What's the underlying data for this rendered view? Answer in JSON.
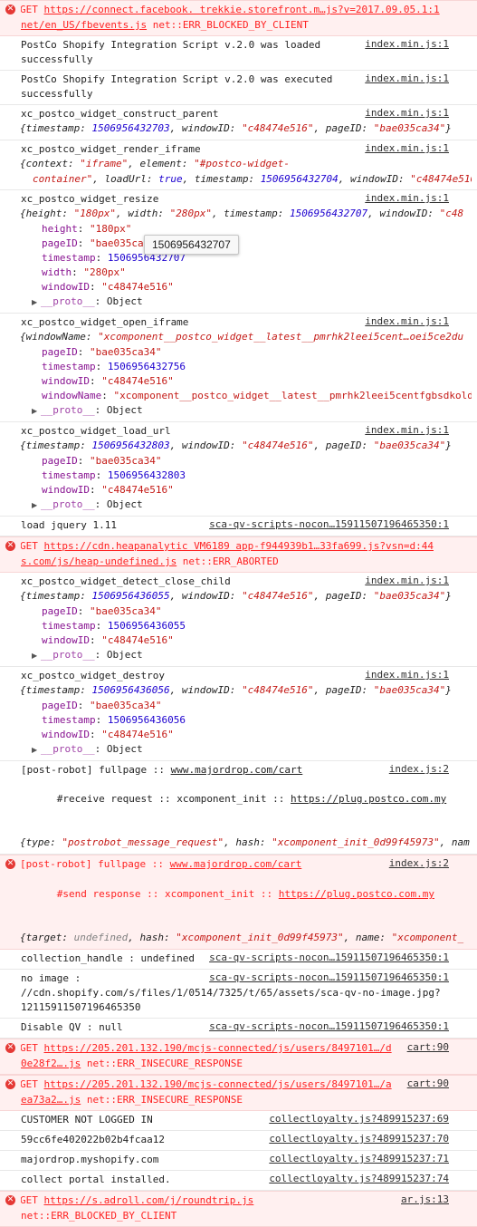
{
  "colors": {
    "error_text": "#fe2222",
    "error_bg": "#fff0f0",
    "string": "#c41a16",
    "number": "#1c00cf",
    "key": "#881391"
  },
  "tooltip": "1506956432707",
  "e1": {
    "l1a": "GET ",
    "url": "https://connect.facebook. trekkie.storefront.m…js?v=2017.09.05.1:1",
    "l2a": "net/en_US/fbevents.js",
    "l2b": " net::ERR_BLOCKED_BY_CLIENT"
  },
  "e2": {
    "text": "PostCo Shopify Integration Script v.2.0 was loaded successfully",
    "src": "index.min.js:1"
  },
  "e3": {
    "text": "PostCo Shopify Integration Script v.2.0 was executed successfully",
    "src": "index.min.js:1"
  },
  "e4": {
    "title": "xc_postco_widget_construct_parent",
    "src": "index.min.js:1",
    "obj": [
      "{timestamp: ",
      "1506956432703",
      ", windowID: ",
      "\"c48474e516\"",
      ", pageID: ",
      "\"bae035ca34\"",
      "}"
    ]
  },
  "e5": {
    "title": "xc_postco_widget_render_iframe",
    "src": "index.min.js:1",
    "l1": [
      "{context: ",
      "\"iframe\"",
      ", element: ",
      "\"#postco-widget-"
    ],
    "l2": [
      "container\"",
      ", loadUrl: ",
      "true",
      ", timestamp: ",
      "1506956432704",
      ", windowID: ",
      "\"c48474e516"
    ]
  },
  "e6": {
    "title": "xc_postco_widget_resize",
    "src": "index.min.js:1",
    "obj": [
      "{height: ",
      "\"180px\"",
      ", width: ",
      "\"280px\"",
      ", timestamp: ",
      "1506956432707",
      ", windowID: ",
      "\"c48"
    ],
    "props": [
      [
        "height",
        "\"180px\""
      ],
      [
        "pageID",
        "\"bae035ca34\""
      ],
      [
        "timestamp",
        "1506956432707"
      ],
      [
        "width",
        "\"280px\""
      ],
      [
        "windowID",
        "\"c48474e516\""
      ]
    ],
    "proto": "__proto__",
    "proto_val": "Object"
  },
  "e7": {
    "title": "xc_postco_widget_open_iframe",
    "src": "index.min.js:1",
    "obj": [
      "{windowName: ",
      "\"xcomponent__postco_widget__latest__pmrhk2leei5cent…oei5ce2du"
    ],
    "props": [
      [
        "pageID",
        "\"bae035ca34\""
      ],
      [
        "timestamp",
        "1506956432756"
      ],
      [
        "windowID",
        "\"c48474e516\""
      ],
      [
        "windowName",
        "\"xcomponent__postco_widget__latest__pmrhk2leei5centfgbsdkoldg"
      ]
    ],
    "proto": "__proto__",
    "proto_val": "Object"
  },
  "e8": {
    "title": "xc_postco_widget_load_url",
    "src": "index.min.js:1",
    "obj": [
      "{timestamp: ",
      "1506956432803",
      ", windowID: ",
      "\"c48474e516\"",
      ", pageID: ",
      "\"bae035ca34\"",
      "}"
    ],
    "props": [
      [
        "pageID",
        "\"bae035ca34\""
      ],
      [
        "timestamp",
        "1506956432803"
      ],
      [
        "windowID",
        "\"c48474e516\""
      ]
    ],
    "proto": "__proto__",
    "proto_val": "Object"
  },
  "e9": {
    "text": "load jquery 1.11",
    "src": "sca-qv-scripts-nocon…15911507196465350:1"
  },
  "e10": {
    "l1a": "GET ",
    "url": "https://cdn.heapanalytic  VM6189 app-f944939b1…33fa699.js?vsn=d:44",
    "l2a": "s.com/js/heap-undefined.js",
    "l2b": " net::ERR_ABORTED"
  },
  "e11": {
    "title": "xc_postco_widget_detect_close_child",
    "src": "index.min.js:1",
    "obj": [
      "{timestamp: ",
      "1506956436055",
      ", windowID: ",
      "\"c48474e516\"",
      ", pageID: ",
      "\"bae035ca34\"",
      "}"
    ],
    "props": [
      [
        "pageID",
        "\"bae035ca34\""
      ],
      [
        "timestamp",
        "1506956436055"
      ],
      [
        "windowID",
        "\"c48474e516\""
      ]
    ],
    "proto": "__proto__",
    "proto_val": "Object"
  },
  "e12": {
    "title": "xc_postco_widget_destroy",
    "src": "index.min.js:1",
    "obj": [
      "{timestamp: ",
      "1506956436056",
      ", windowID: ",
      "\"c48474e516\"",
      ", pageID: ",
      "\"bae035ca34\"",
      "}"
    ],
    "props": [
      [
        "pageID",
        "\"bae035ca34\""
      ],
      [
        "timestamp",
        "1506956436056"
      ],
      [
        "windowID",
        "\"c48474e516\""
      ]
    ],
    "proto": "__proto__",
    "proto_val": "Object"
  },
  "e13": {
    "a": "[post-robot] fullpage :: ",
    "url": "www.majordrop.com/cart",
    "src": "index.js:2",
    "b": "#receive request :: xcomponent_init :: ",
    "url2": "https://plug.postco.com.my",
    "obj": [
      "{type: ",
      "\"postrobot_message_request\"",
      ", hash: ",
      "\"xcomponent_init_0d99f45973\"",
      ", nam"
    ]
  },
  "e14": {
    "a": "[post-robot] fullpage :: ",
    "url": "www.majordrop.com/cart",
    "src": "index.js:2",
    "b": "#send response :: xcomponent_init :: ",
    "url2": "https://plug.postco.com.my",
    "obj": [
      "{target: ",
      "undefined",
      ", hash: ",
      "\"xcomponent_init_0d99f45973\"",
      ", name: ",
      "\"xcomponent_"
    ]
  },
  "e15": {
    "text": "collection_handle : undefined",
    "src": "sca-qv-scripts-nocon…15911507196465350:1"
  },
  "e16": {
    "l1": "no image :",
    "l2": "//cdn.shopify.com/s/files/1/0514/7325/t/65/assets/sca-qv-no-image.jpg?",
    "l3": "12115911507196465350",
    "src": "sca-qv-scripts-nocon…15911507196465350:1"
  },
  "e17": {
    "text": "Disable QV : null",
    "src": "sca-qv-scripts-nocon…15911507196465350:1"
  },
  "e18": {
    "l1a": "GET ",
    "url": "https://205.201.132.190/mcjs-connected/js/users/8497101…/d",
    "src": "cart:90",
    "l2a": "0e28f2….js",
    "l2b": " net::ERR_INSECURE_RESPONSE"
  },
  "e19": {
    "l1a": "GET ",
    "url": "https://205.201.132.190/mcjs-connected/js/users/8497101…/a",
    "src": "cart:90",
    "l2a": "ea73a2….js",
    "l2b": " net::ERR_INSECURE_RESPONSE"
  },
  "e20": {
    "text": "CUSTOMER NOT LOGGED IN",
    "src": "collectloyalty.js?489915237:69"
  },
  "e21": {
    "text": "59cc6fe402022b02b4fcaa12",
    "src": "collectloyalty.js?489915237:70"
  },
  "e22": {
    "text": "majordrop.myshopify.com",
    "src": "collectloyalty.js?489915237:71"
  },
  "e23": {
    "text": "collect portal installed.",
    "src": "collectloyalty.js?489915237:74"
  },
  "e24": {
    "l1a": "GET ",
    "url": "https://s.adroll.com/j/roundtrip.js",
    "src": "ar.js:13",
    "l2": "net::ERR_BLOCKED_BY_CLIENT"
  }
}
